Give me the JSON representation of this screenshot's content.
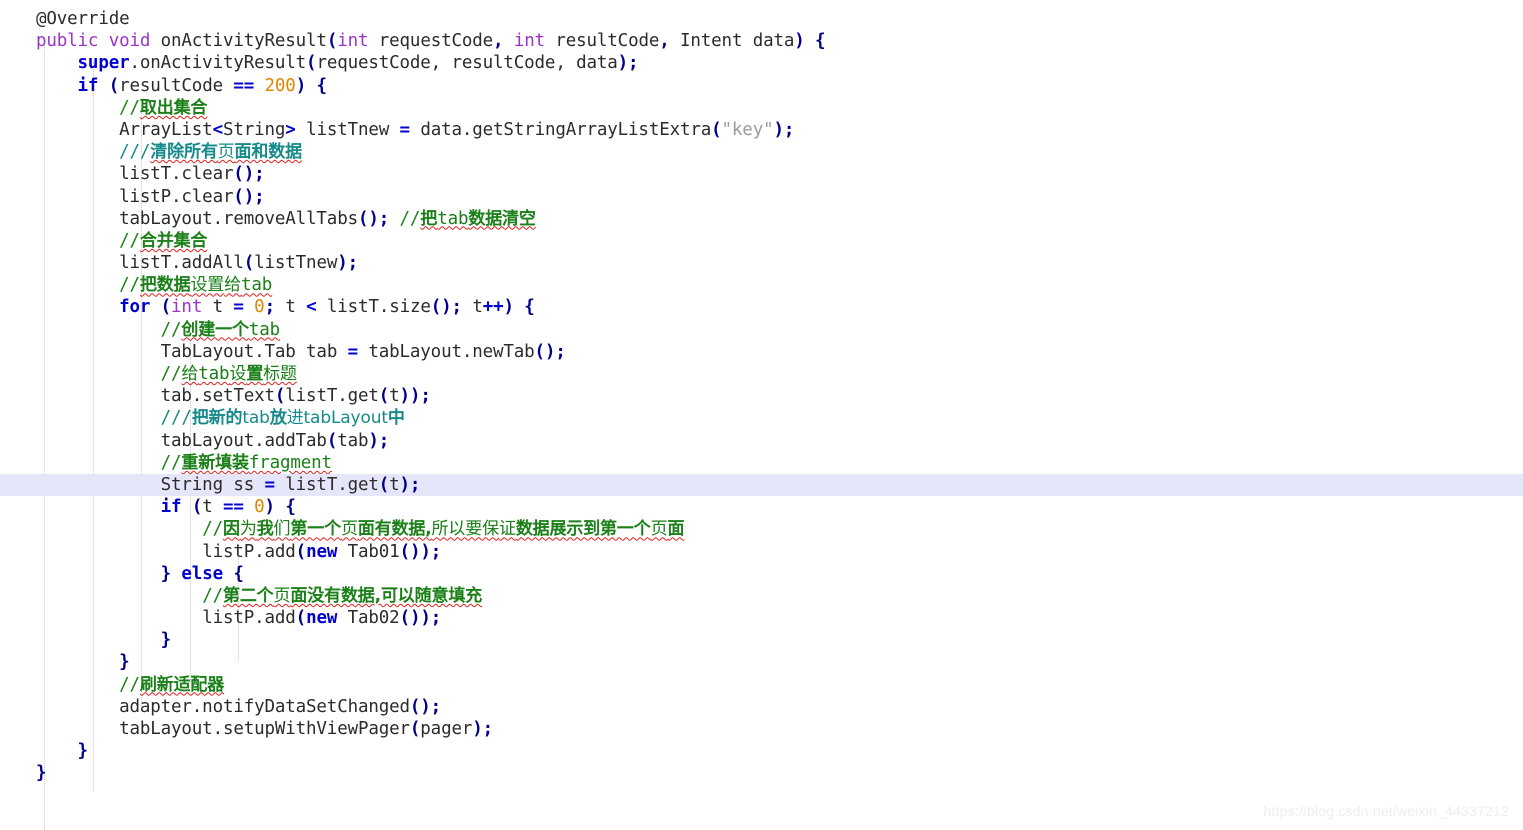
{
  "editor": {
    "language": "java",
    "background_color": "#ffffff",
    "current_line_highlight_color": "#e6e6fa",
    "indent_guide_color": "#c8c8c8",
    "colors": {
      "keyword_modifier": "#9a33c8",
      "keyword_control": "#0000d0",
      "punctuation": "#00008b",
      "number": "#e08600",
      "string": "#9b9b9b",
      "comment": "#1a8017",
      "doc_comment": "#168a8a",
      "default_text": "#2b2b2b",
      "spellcheck_underline": "#e02020"
    },
    "indent_guides_x": [
      44,
      93,
      141,
      190,
      238
    ],
    "current_line_index": 20,
    "lines": [
      {
        "indent": 1,
        "text": "@Override"
      },
      {
        "indent": 1,
        "text": "public void onActivityResult(int requestCode, int resultCode, Intent data) {"
      },
      {
        "indent": 2,
        "text": "super.onActivityResult(requestCode, resultCode, data);"
      },
      {
        "indent": 2,
        "text": "if (resultCode == 200) {"
      },
      {
        "indent": 3,
        "text": "//取出集合"
      },
      {
        "indent": 3,
        "text": "ArrayList<String> listTnew = data.getStringArrayListExtra(\"key\");"
      },
      {
        "indent": 3,
        "text": "///清除所有页面和数据"
      },
      {
        "indent": 3,
        "text": "listT.clear();"
      },
      {
        "indent": 3,
        "text": "listP.clear();"
      },
      {
        "indent": 3,
        "text": "tabLayout.removeAllTabs(); //把tab数据清空"
      },
      {
        "indent": 3,
        "text": "//合并集合"
      },
      {
        "indent": 3,
        "text": "listT.addAll(listTnew);"
      },
      {
        "indent": 3,
        "text": "//把数据设置给tab"
      },
      {
        "indent": 3,
        "text": "for (int t = 0; t < listT.size(); t++) {"
      },
      {
        "indent": 4,
        "text": "//创建一个tab"
      },
      {
        "indent": 4,
        "text": "TabLayout.Tab tab = tabLayout.newTab();"
      },
      {
        "indent": 4,
        "text": "//给tab设置标题"
      },
      {
        "indent": 4,
        "text": "tab.setText(listT.get(t));"
      },
      {
        "indent": 4,
        "text": "///把新的tab放进tabLayout中"
      },
      {
        "indent": 4,
        "text": "tabLayout.addTab(tab);"
      },
      {
        "indent": 4,
        "text": "//重新填装fragment"
      },
      {
        "indent": 4,
        "text": "String ss = listT.get(t);"
      },
      {
        "indent": 4,
        "text": "if (t == 0) {"
      },
      {
        "indent": 5,
        "text": "//因为我们第一个页面有数据,所以要保证数据展示到第一个页面"
      },
      {
        "indent": 5,
        "text": "listP.add(new Tab01());"
      },
      {
        "indent": 4,
        "text": "} else {"
      },
      {
        "indent": 5,
        "text": "//第二个页面没有数据,可以随意填充"
      },
      {
        "indent": 5,
        "text": "listP.add(new Tab02());"
      },
      {
        "indent": 4,
        "text": "}"
      },
      {
        "indent": 3,
        "text": "}"
      },
      {
        "indent": 3,
        "text": "//刷新适配器"
      },
      {
        "indent": 3,
        "text": "adapter.notifyDataSetChanged();"
      },
      {
        "indent": 3,
        "text": "tabLayout.setupWithViewPager(pager);"
      },
      {
        "indent": 2,
        "text": "}"
      },
      {
        "indent": 1,
        "text": "}"
      }
    ]
  },
  "watermark": {
    "text": "https://blog.csdn.net/weixin_44337212"
  }
}
